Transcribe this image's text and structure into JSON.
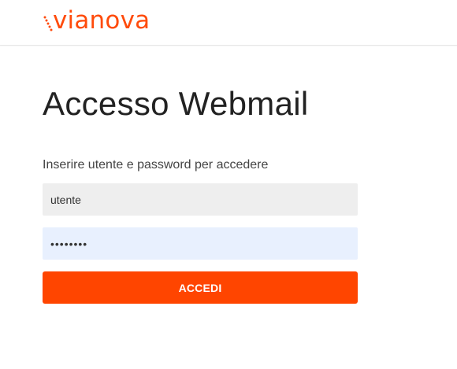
{
  "brand": {
    "name": "vianova",
    "color": "#ff4b0b"
  },
  "page": {
    "title": "Accesso Webmail",
    "subtitle": "Inserire utente e password per accedere"
  },
  "form": {
    "username": {
      "value": "utente",
      "placeholder": "utente"
    },
    "password": {
      "value": "••••••••"
    },
    "submit_label": "ACCEDI",
    "button_color": "#ff4500"
  }
}
